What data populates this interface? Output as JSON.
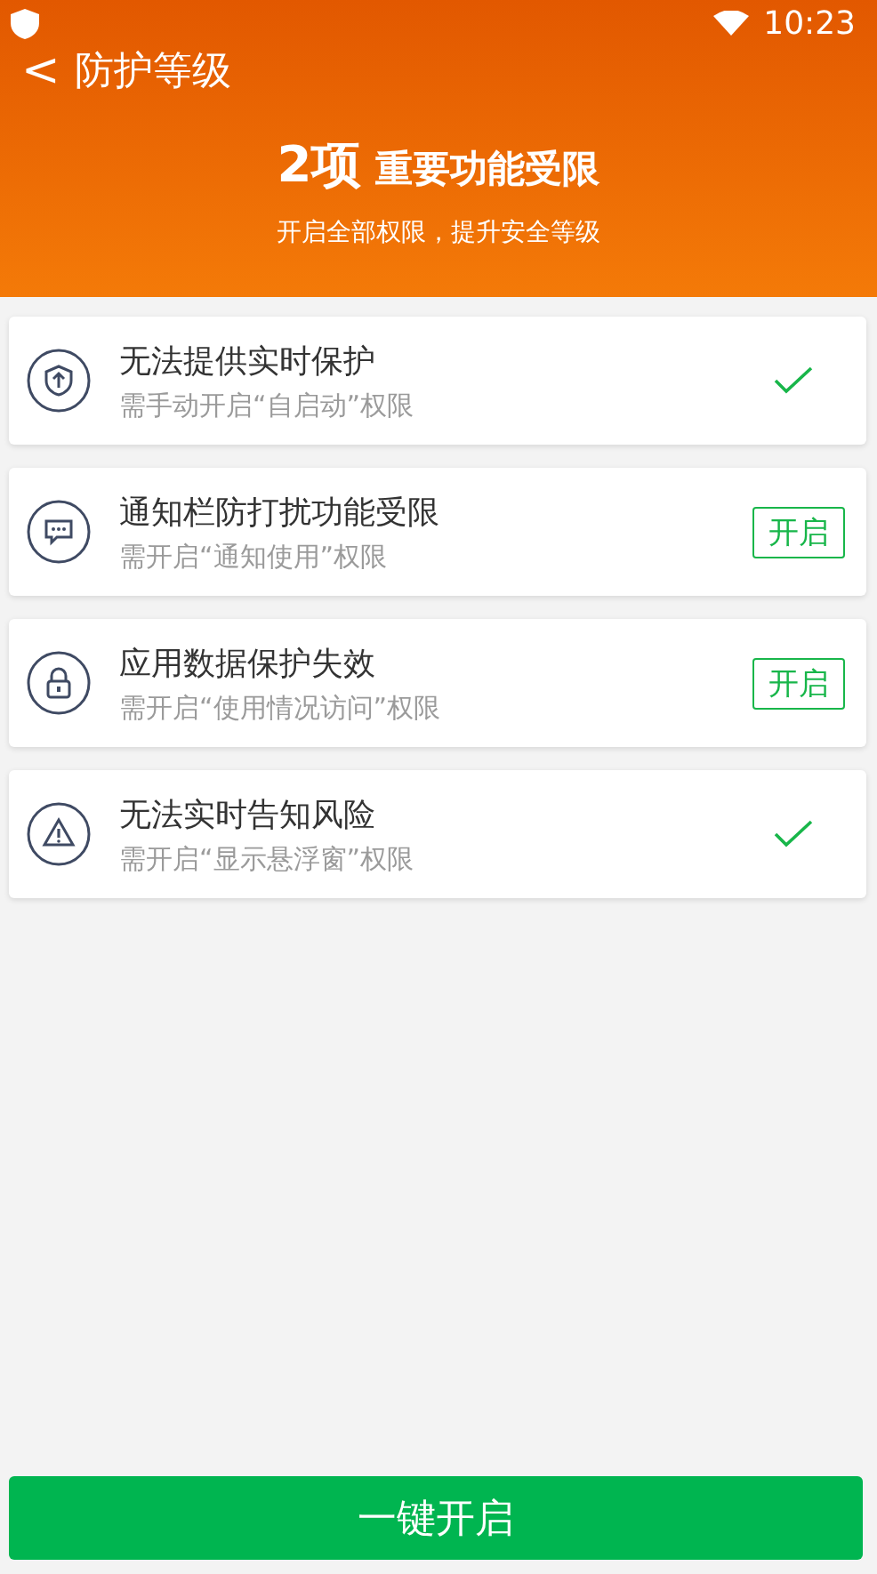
{
  "status_bar": {
    "time": "10:23"
  },
  "header": {
    "back": "<",
    "title": "防护等级",
    "count": "2项",
    "headline": "重要功能受限",
    "subtitle": "开启全部权限，提升安全等级"
  },
  "items": [
    {
      "title": "无法提供实时保护",
      "subtitle": "需手动开启“自启动”权限",
      "kind": "done"
    },
    {
      "title": "通知栏防打扰功能受限",
      "subtitle": "需开启“通知使用”权限",
      "kind": "action",
      "button": "开启"
    },
    {
      "title": "应用数据保护失效",
      "subtitle": "需开启“使用情况访问”权限",
      "kind": "action",
      "button": "开启"
    },
    {
      "title": "无法实时告知风险",
      "subtitle": "需开启“显示悬浮窗”权限",
      "kind": "done"
    }
  ],
  "main_button": "一键开启"
}
